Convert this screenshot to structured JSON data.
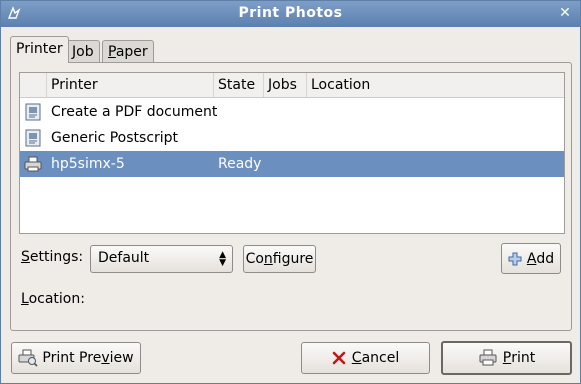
{
  "window": {
    "title": "Print Photos"
  },
  "tabs": [
    {
      "label_pre": "",
      "label_u": "",
      "label_post": "Printer"
    },
    {
      "label_pre": "",
      "label_u": "J",
      "label_post": "ob"
    },
    {
      "label_pre": "",
      "label_u": "P",
      "label_post": "aper"
    }
  ],
  "printer_list": {
    "columns": [
      "Printer",
      "State",
      "Jobs",
      "Location"
    ],
    "rows": [
      {
        "name": "Create a PDF document",
        "state": "",
        "icon": "document-printer-icon"
      },
      {
        "name": "Generic Postscript",
        "state": "",
        "icon": "document-printer-icon"
      },
      {
        "name": "hp5simx-5",
        "state": "Ready",
        "icon": "printer-icon",
        "selected": true
      }
    ]
  },
  "settings": {
    "label_u": "S",
    "label_post": "ettings:",
    "value": "Default",
    "configure_pre": "Co",
    "configure_u": "n",
    "configure_post": "figure",
    "add_u": "A",
    "add_post": "dd"
  },
  "location": {
    "label_u": "L",
    "label_post": "ocation:"
  },
  "footer": {
    "preview_pre": "Print Pre",
    "preview_u": "v",
    "preview_post": "iew",
    "cancel_u": "C",
    "cancel_post": "ancel",
    "print_u": "P",
    "print_post": "rint"
  },
  "colors": {
    "titlebar": "#6f90bd",
    "selection": "#6b8fbf",
    "background": "#efebe7"
  }
}
